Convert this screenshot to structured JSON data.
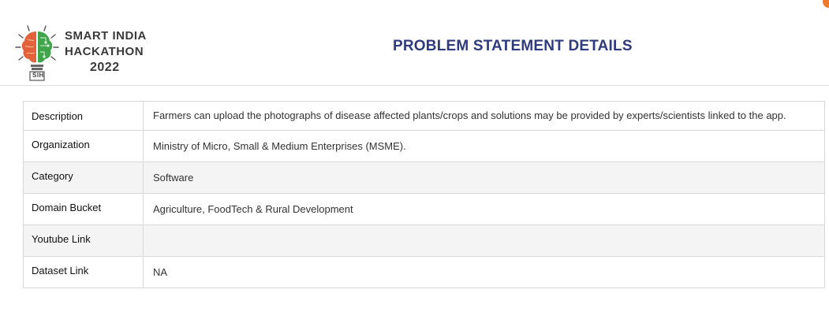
{
  "header": {
    "logo": {
      "line1": "SMART INDIA",
      "line2": "HACKATHON",
      "line3": "2022",
      "badge": "SIH"
    },
    "title": "PROBLEM STATEMENT DETAILS"
  },
  "details": [
    {
      "label": "Description",
      "value": "Farmers can upload the photographs of disease affected plants/crops and solutions may be provided by experts/scientists linked to the app."
    },
    {
      "label": "Organization",
      "value": "Ministry of Micro, Small & Medium Enterprises (MSME)."
    },
    {
      "label": "Category",
      "value": "Software"
    },
    {
      "label": "Domain Bucket",
      "value": "Agriculture, FoodTech & Rural Development"
    },
    {
      "label": "Youtube Link",
      "value": ""
    },
    {
      "label": "Dataset Link",
      "value": "NA"
    }
  ],
  "colors": {
    "title": "#2f3b7c",
    "brain_left": "#e2623a",
    "brain_right": "#3fa44a",
    "accent_dot": "#f07a2a"
  }
}
